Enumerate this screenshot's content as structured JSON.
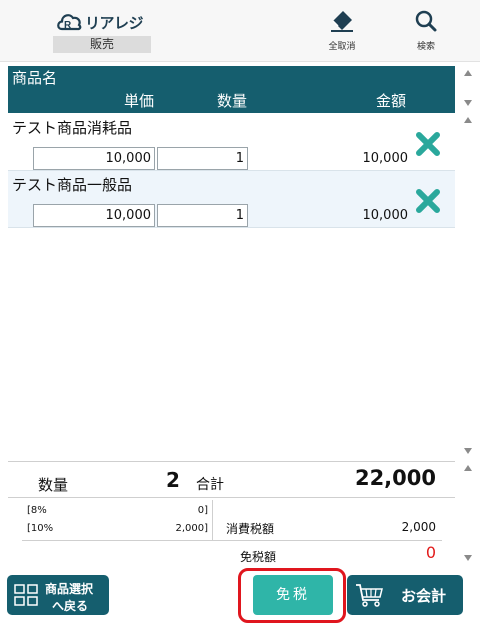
{
  "header": {
    "logo_text": "リアレジ",
    "mode_label": "販売",
    "clear_all_label": "全取消",
    "search_label": "検索"
  },
  "table": {
    "headers": {
      "name": "商品名",
      "unit_price": "単価",
      "quantity": "数量",
      "amount": "金額"
    },
    "rows": [
      {
        "name": "テスト商品消耗品",
        "unit_price": "10,000",
        "quantity": "1",
        "amount": "10,000"
      },
      {
        "name": "テスト商品一般品",
        "unit_price": "10,000",
        "quantity": "1",
        "amount": "10,000"
      }
    ]
  },
  "totals": {
    "quantity_label": "数量",
    "quantity_value": "2",
    "sum_label": "合計",
    "sum_value": "22,000",
    "tax8_label": "[8%",
    "tax8_value": "0]",
    "tax10_label": "[10%",
    "tax10_value": "2,000]",
    "consumption_tax_label": "消費税額",
    "consumption_tax_value": "2,000",
    "tax_exempt_label": "免税額",
    "tax_exempt_value": "0"
  },
  "buttons": {
    "product_select_line1": "商品選択",
    "product_select_line2": "へ戻る",
    "tax_exempt": "免税",
    "checkout": "お会計"
  },
  "colors": {
    "teal_dark": "#155e6e",
    "teal_light": "#2fb5a8",
    "delete_icon": "#2aa89c",
    "highlight_red": "#e0161e",
    "exempt_value_red": "#e21b1b"
  }
}
